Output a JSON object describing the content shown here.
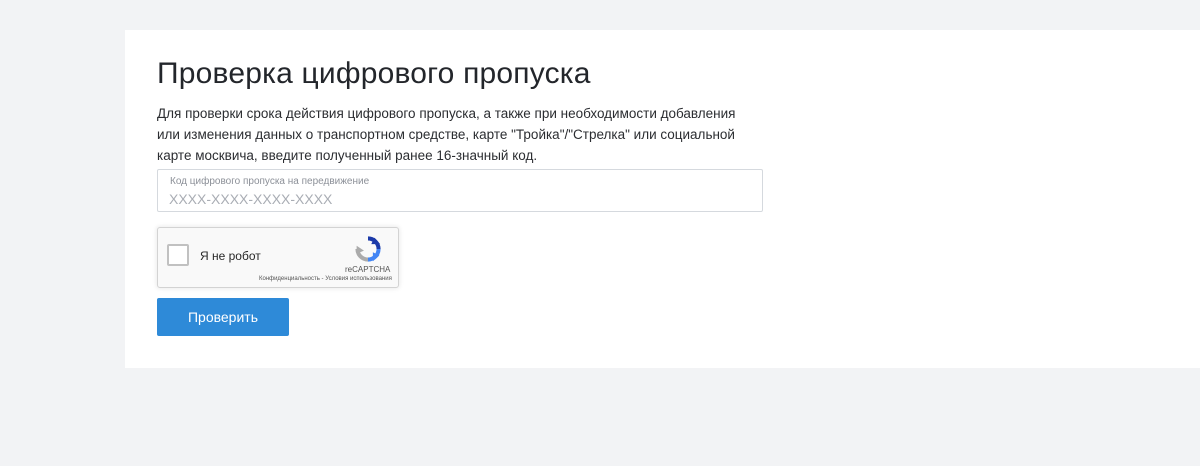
{
  "page": {
    "title": "Проверка цифрового пропуска",
    "description": "Для проверки срока действия цифрового пропуска, а также при необходимости добавления или изменения данных о транспортном средстве, карте \"Тройка\"/\"Стрелка\" или социальной карте москвича, введите полученный ранее 16-значный код."
  },
  "pass_field": {
    "label": "Код цифрового пропуска на передвижение",
    "value": "",
    "placeholder": "XXXX-XXXX-XXXX-XXXX"
  },
  "captcha": {
    "label": "Я не робот",
    "brand": "reCAPTCHA",
    "privacy_link": "Конфиденциальность",
    "separator": " - ",
    "terms_link": "Условия использования",
    "icon": "recaptcha-logo-icon"
  },
  "actions": {
    "submit_label": "Проверить"
  },
  "colors": {
    "page_background": "#f2f3f5",
    "card_background": "#ffffff",
    "button": "#2e8ad8",
    "recaptcha_blue": "#1c3aa9",
    "recaptcha_light_blue": "#4285f4",
    "recaptcha_grey": "#ababab"
  }
}
